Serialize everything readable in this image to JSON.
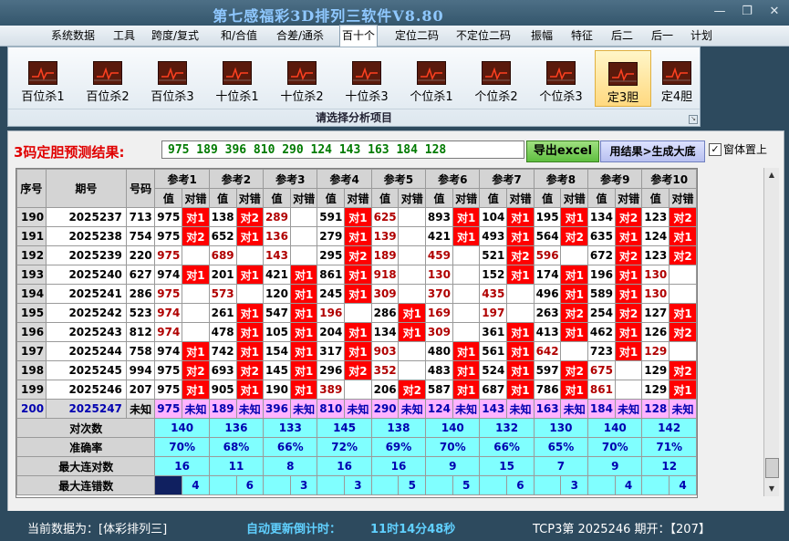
{
  "window": {
    "title": "第七感福彩3D排列三软件V8.80",
    "minimize": "—",
    "restore": "❐",
    "close": "✕"
  },
  "menu": [
    "系统数据",
    "工具",
    "跨度/复式",
    "和/合值",
    "合差/通杀",
    "百十个",
    "定位二码",
    "不定位二码",
    "振幅",
    "特征",
    "后二",
    "后一",
    "计划"
  ],
  "menu_active_index": 5,
  "ribbon": {
    "buttons": [
      "百位杀1",
      "百位杀2",
      "百位杀3",
      "十位杀1",
      "十位杀2",
      "十位杀3",
      "个位杀1",
      "个位杀2",
      "个位杀3",
      "定3胆",
      "定4胆"
    ],
    "selected_index": 9,
    "icon": "chart-icon",
    "caption": "请选择分析项目"
  },
  "prediction": {
    "label": "3码定胆预测结果:",
    "values": "975  189  396  810  290  124  143  163  184  128",
    "export_label": "导出excel",
    "generate_label": "用结果>生成大底",
    "ontop_label": "窗体置上",
    "ontop_checked": true
  },
  "table": {
    "headers": {
      "seq": "序号",
      "period": "期号",
      "code": "号码",
      "val": "值",
      "result": "对错"
    },
    "refs": [
      "参考1",
      "参考2",
      "参考3",
      "参考4",
      "参考5",
      "参考6",
      "参考7",
      "参考8",
      "参考9",
      "参考10"
    ],
    "rows": [
      {
        "seq": "190",
        "period": "2025237",
        "code": "713",
        "cells": [
          [
            "975",
            "对1"
          ],
          [
            "138",
            "对2"
          ],
          [
            "289",
            ""
          ],
          [
            "591",
            "对1"
          ],
          [
            "625",
            ""
          ],
          [
            "893",
            "对1"
          ],
          [
            "104",
            "对1"
          ],
          [
            "195",
            "对1"
          ],
          [
            "134",
            "对2"
          ],
          [
            "123",
            "对2"
          ]
        ]
      },
      {
        "seq": "191",
        "period": "2025238",
        "code": "754",
        "cells": [
          [
            "975",
            "对2"
          ],
          [
            "652",
            "对1"
          ],
          [
            "136",
            ""
          ],
          [
            "279",
            "对1"
          ],
          [
            "139",
            ""
          ],
          [
            "421",
            "对1"
          ],
          [
            "493",
            "对1"
          ],
          [
            "564",
            "对2"
          ],
          [
            "635",
            "对1"
          ],
          [
            "124",
            "对1"
          ]
        ]
      },
      {
        "seq": "192",
        "period": "2025239",
        "code": "220",
        "cells": [
          [
            "975",
            ""
          ],
          [
            "689",
            ""
          ],
          [
            "143",
            ""
          ],
          [
            "295",
            "对2"
          ],
          [
            "189",
            ""
          ],
          [
            "459",
            ""
          ],
          [
            "521",
            "对2"
          ],
          [
            "596",
            ""
          ],
          [
            "672",
            "对2"
          ],
          [
            "123",
            "对2"
          ]
        ]
      },
      {
        "seq": "193",
        "period": "2025240",
        "code": "627",
        "cells": [
          [
            "974",
            "对1"
          ],
          [
            "201",
            "对1"
          ],
          [
            "421",
            "对1"
          ],
          [
            "861",
            "对1"
          ],
          [
            "918",
            ""
          ],
          [
            "130",
            ""
          ],
          [
            "152",
            "对1"
          ],
          [
            "174",
            "对1"
          ],
          [
            "196",
            "对1"
          ],
          [
            "130",
            ""
          ]
        ]
      },
      {
        "seq": "194",
        "period": "2025241",
        "code": "286",
        "cells": [
          [
            "975",
            ""
          ],
          [
            "573",
            ""
          ],
          [
            "120",
            "对1"
          ],
          [
            "245",
            "对1"
          ],
          [
            "309",
            ""
          ],
          [
            "370",
            ""
          ],
          [
            "435",
            ""
          ],
          [
            "496",
            "对1"
          ],
          [
            "589",
            "对1"
          ],
          [
            "130",
            ""
          ]
        ]
      },
      {
        "seq": "195",
        "period": "2025242",
        "code": "523",
        "cells": [
          [
            "974",
            ""
          ],
          [
            "261",
            "对1"
          ],
          [
            "547",
            "对1"
          ],
          [
            "196",
            ""
          ],
          [
            "286",
            "对1"
          ],
          [
            "169",
            ""
          ],
          [
            "197",
            ""
          ],
          [
            "263",
            "对2"
          ],
          [
            "254",
            "对2"
          ],
          [
            "127",
            "对1"
          ]
        ]
      },
      {
        "seq": "196",
        "period": "2025243",
        "code": "812",
        "cells": [
          [
            "974",
            ""
          ],
          [
            "478",
            "对1"
          ],
          [
            "105",
            "对1"
          ],
          [
            "204",
            "对1"
          ],
          [
            "134",
            "对1"
          ],
          [
            "309",
            ""
          ],
          [
            "361",
            "对1"
          ],
          [
            "413",
            "对1"
          ],
          [
            "462",
            "对1"
          ],
          [
            "126",
            "对2"
          ]
        ]
      },
      {
        "seq": "197",
        "period": "2025244",
        "code": "758",
        "cells": [
          [
            "974",
            "对1"
          ],
          [
            "742",
            "对1"
          ],
          [
            "154",
            "对1"
          ],
          [
            "317",
            "对1"
          ],
          [
            "903",
            ""
          ],
          [
            "480",
            "对1"
          ],
          [
            "561",
            "对1"
          ],
          [
            "642",
            ""
          ],
          [
            "723",
            "对1"
          ],
          [
            "129",
            ""
          ]
        ]
      },
      {
        "seq": "198",
        "period": "2025245",
        "code": "994",
        "cells": [
          [
            "975",
            "对2"
          ],
          [
            "693",
            "对2"
          ],
          [
            "145",
            "对1"
          ],
          [
            "296",
            "对2"
          ],
          [
            "352",
            ""
          ],
          [
            "483",
            "对1"
          ],
          [
            "524",
            "对1"
          ],
          [
            "597",
            "对2"
          ],
          [
            "675",
            ""
          ],
          [
            "129",
            "对2"
          ]
        ]
      },
      {
        "seq": "199",
        "period": "2025246",
        "code": "207",
        "cells": [
          [
            "975",
            "对1"
          ],
          [
            "905",
            "对1"
          ],
          [
            "190",
            "对1"
          ],
          [
            "389",
            ""
          ],
          [
            "206",
            "对2"
          ],
          [
            "587",
            "对1"
          ],
          [
            "687",
            "对1"
          ],
          [
            "786",
            "对1"
          ],
          [
            "861",
            ""
          ],
          [
            "129",
            "对1"
          ]
        ]
      }
    ],
    "future": {
      "seq": "200",
      "period": "2025247",
      "code": "未知",
      "cells": [
        [
          "975",
          "未知"
        ],
        [
          "189",
          "未知"
        ],
        [
          "396",
          "未知"
        ],
        [
          "810",
          "未知"
        ],
        [
          "290",
          "未知"
        ],
        [
          "124",
          "未知"
        ],
        [
          "143",
          "未知"
        ],
        [
          "163",
          "未知"
        ],
        [
          "184",
          "未知"
        ],
        [
          "128",
          "未知"
        ]
      ]
    },
    "stats": [
      {
        "label": "对次数",
        "values": [
          "140",
          "136",
          "133",
          "145",
          "138",
          "140",
          "132",
          "130",
          "140",
          "142"
        ],
        "offset": "half"
      },
      {
        "label": "准确率",
        "values": [
          "70%",
          "68%",
          "66%",
          "72%",
          "69%",
          "70%",
          "66%",
          "65%",
          "70%",
          "71%"
        ],
        "offset": "half"
      },
      {
        "label": "最大连对数",
        "values": [
          "16",
          "11",
          "8",
          "16",
          "16",
          "9",
          "15",
          "7",
          "9",
          "12"
        ],
        "offset": "half"
      },
      {
        "label": "最大连错数",
        "values": [
          "4",
          "6",
          "3",
          "3",
          "5",
          "5",
          "6",
          "3",
          "4",
          "4"
        ],
        "offset": "right"
      }
    ]
  },
  "statusbar": {
    "current_data": "当前数据为：[体彩排列三]",
    "countdown_label": "自动更新倒计时：",
    "countdown": "11时14分48秒",
    "draw": "TCP3第 2025246 期开：【207】"
  },
  "colors": {
    "hit": "#ff0000",
    "future": "#ffb3ff",
    "stat": "#80ffff",
    "pred_text": "#007a00",
    "pred_label": "#e00000"
  }
}
